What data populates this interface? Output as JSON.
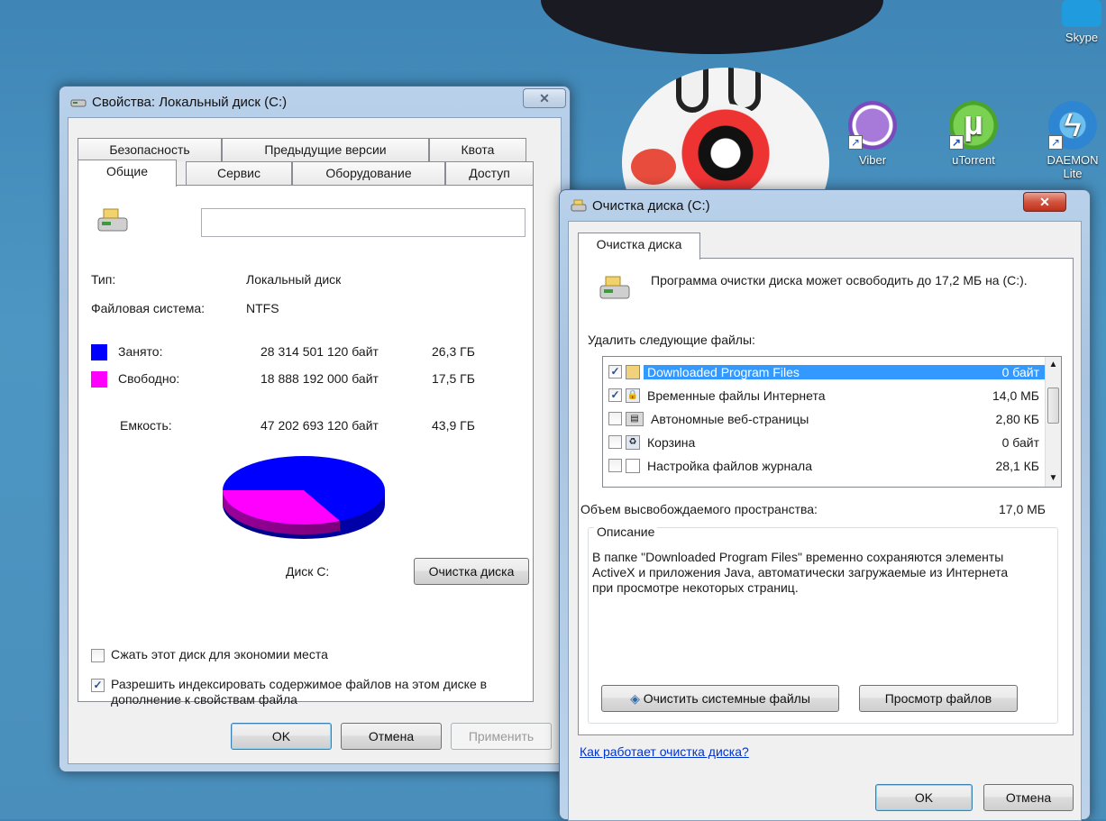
{
  "desktop": {
    "icons": [
      {
        "label": "Skype",
        "icon": "skype-icon"
      },
      {
        "label": "Viber",
        "icon": "viber-icon"
      },
      {
        "label": "uTorrent",
        "icon": "utorrent-icon"
      },
      {
        "label": "DAEMON Lite",
        "icon": "daemon-tools-icon"
      }
    ]
  },
  "props_window": {
    "title": "Свойства: Локальный диск (C:)",
    "tabs_top": [
      "Безопасность",
      "Предыдущие версии",
      "Квота"
    ],
    "tabs_bottom": [
      "Общие",
      "Сервис",
      "Оборудование",
      "Доступ"
    ],
    "active_tab": "Общие",
    "name_field_value": "",
    "type_label": "Тип:",
    "type_value": "Локальный диск",
    "fs_label": "Файловая система:",
    "fs_value": "NTFS",
    "used": {
      "label": "Занято:",
      "bytes": "28 314 501 120 байт",
      "gb": "26,3 ГБ",
      "color": "#0000ff"
    },
    "free": {
      "label": "Свободно:",
      "bytes": "18 888 192 000 байт",
      "gb": "17,5 ГБ",
      "color": "#ff00ff"
    },
    "capacity": {
      "label": "Емкость:",
      "bytes": "47 202 693 120 байт",
      "gb": "43,9 ГБ"
    },
    "disk_label": "Диск C:",
    "cleanup_button": "Очистка диска",
    "compress_label": "Сжать этот диск для экономии места",
    "compress_checked": false,
    "index_label": "Разрешить индексировать содержимое файлов на этом диске в дополнение к свойствам файла",
    "index_checked": true,
    "ok": "OK",
    "cancel": "Отмена",
    "apply": "Применить"
  },
  "cleanup_window": {
    "title": "Очистка диска  (C:)",
    "tab": "Очистка диска",
    "intro": "Программа очистки диска может освободить до 17,2 МБ на  (C:).",
    "delete_label": "Удалить следующие файлы:",
    "files": [
      {
        "name": "Downloaded Program Files",
        "size": "0 байт",
        "checked": true,
        "selected": true,
        "icon": "folder-icon"
      },
      {
        "name": "Временные файлы Интернета",
        "size": "14,0 МБ",
        "checked": true,
        "selected": false,
        "icon": "lock-file-icon"
      },
      {
        "name": "Автономные веб-страницы",
        "size": "2,80 КБ",
        "checked": false,
        "selected": false,
        "icon": "offline-pages-icon"
      },
      {
        "name": "Корзина",
        "size": "0 байт",
        "checked": false,
        "selected": false,
        "icon": "recycle-bin-icon"
      },
      {
        "name": "Настройка файлов журнала",
        "size": "28,1 КБ",
        "checked": false,
        "selected": false,
        "icon": "document-icon"
      }
    ],
    "space_label": "Объем высвобождаемого пространства:",
    "space_value": "17,0 МБ",
    "description_title": "Описание",
    "description_text": "В папке \"Downloaded Program Files\" временно сохраняются элементы ActiveX и приложения Java, автоматически загружаемые из Интернета при просмотре некоторых страниц.",
    "clean_system_button": "Очистить системные файлы",
    "view_files_button": "Просмотр файлов",
    "help_link": "Как работает очистка диска?",
    "ok": "OK",
    "cancel": "Отмена"
  }
}
